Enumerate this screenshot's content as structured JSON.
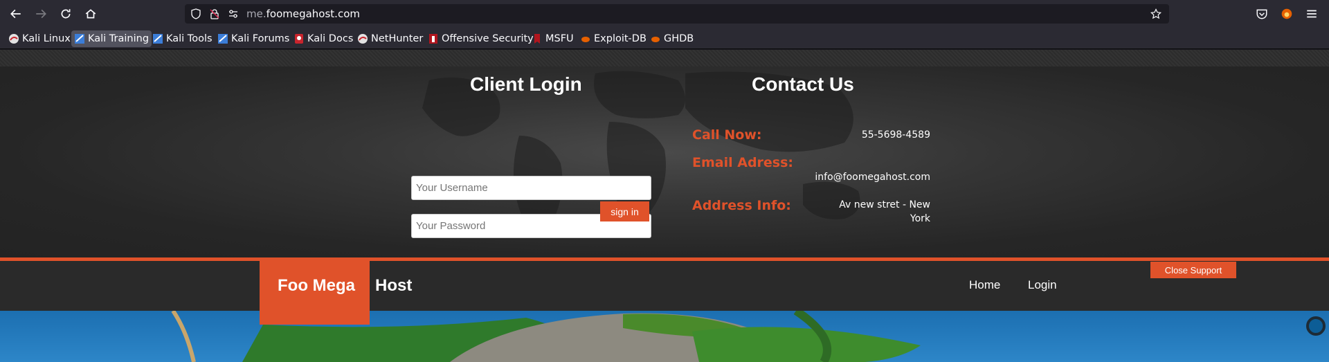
{
  "browser": {
    "url_prefix": "me.",
    "url_domain": "foomegahost.com",
    "icons": [
      "back-icon",
      "forward-icon",
      "reload-icon",
      "home-icon",
      "shield-icon",
      "lock-icon",
      "permissions-icon",
      "star-icon",
      "pocket-icon",
      "extension-icon",
      "menu-icon"
    ]
  },
  "bookmarks": [
    {
      "label": "Kali Linux"
    },
    {
      "label": "Kali Training"
    },
    {
      "label": "Kali Tools"
    },
    {
      "label": "Kali Forums"
    },
    {
      "label": "Kali Docs"
    },
    {
      "label": "NetHunter"
    },
    {
      "label": "Offensive Security"
    },
    {
      "label": "MSFU"
    },
    {
      "label": "Exploit-DB"
    },
    {
      "label": "GHDB"
    }
  ],
  "login": {
    "title": "Client Login",
    "username_placeholder": "Your Username",
    "password_placeholder": "Your Password",
    "signin_label": "sign in"
  },
  "contact": {
    "title": "Contact Us",
    "call_label": "Call Now:",
    "call_value": "55-5698-4589",
    "email_label": "Email Adress:",
    "email_value": "info@foomegahost.com",
    "address_label": "Address Info:",
    "address_line1": "Av new stret - New",
    "address_line2": "York"
  },
  "header": {
    "logo_part1": "Foo Mega",
    "logo_part2": "Host",
    "menu_home": "Home",
    "menu_login": "Login",
    "close_support": "Close Support"
  },
  "colors": {
    "accent": "#e0522a",
    "background": "#2a2a2a",
    "browser_chrome": "#2b2a33"
  }
}
